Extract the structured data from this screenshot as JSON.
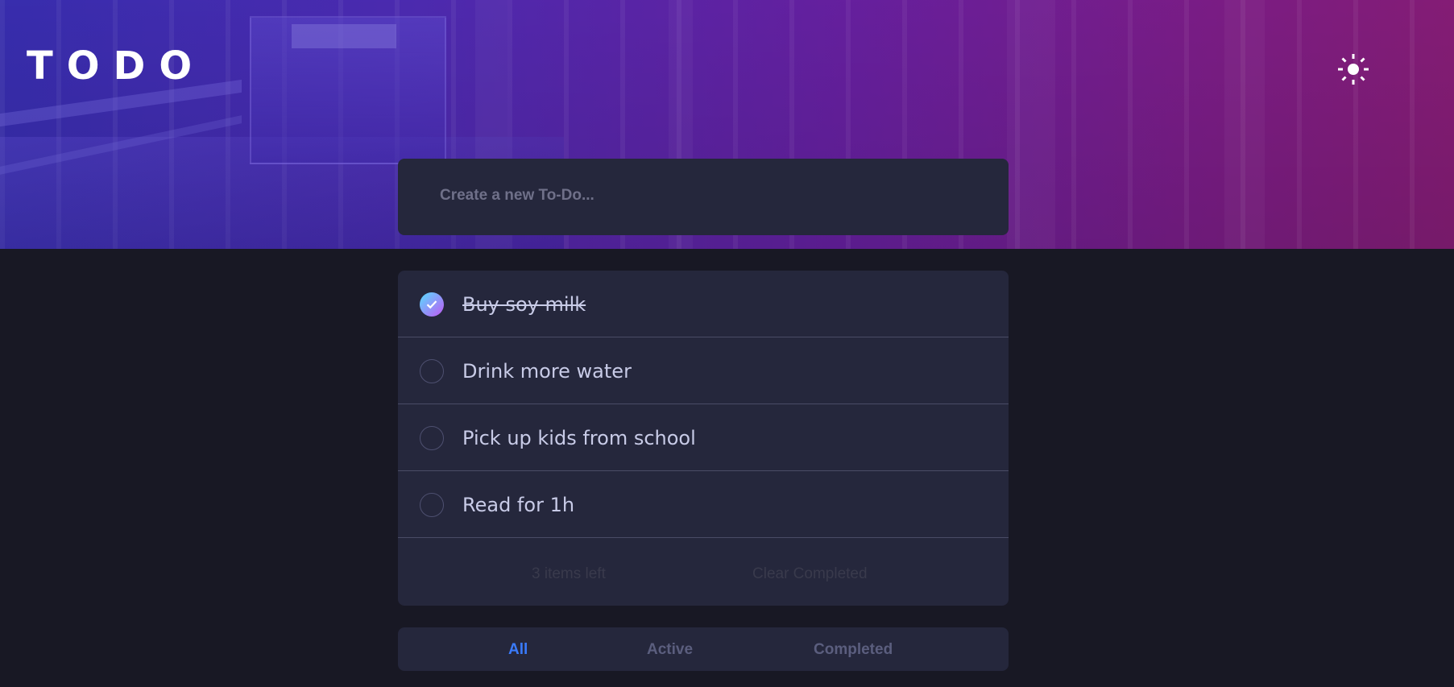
{
  "app": {
    "title": "TODO"
  },
  "theme_toggle": {
    "icon": "sun-icon"
  },
  "new_todo": {
    "placeholder": "Create a new To-Do..."
  },
  "todos": [
    {
      "text": "Buy soy milk",
      "completed": true
    },
    {
      "text": "Drink more water",
      "completed": false
    },
    {
      "text": "Pick up kids from school",
      "completed": false
    },
    {
      "text": "Read for 1h",
      "completed": false
    }
  ],
  "footer": {
    "items_left": "3 items left",
    "clear_completed": "Clear Completed"
  },
  "filters": {
    "all": "All",
    "active": "Active",
    "completed": "Completed",
    "selected": "All"
  },
  "colors": {
    "background": "#181824",
    "card": "#25273c",
    "text": "#c8cbe7",
    "active_filter": "#3a7bfd",
    "check_gradient_start": "#57ddff",
    "check_gradient_end": "#c058f3"
  }
}
